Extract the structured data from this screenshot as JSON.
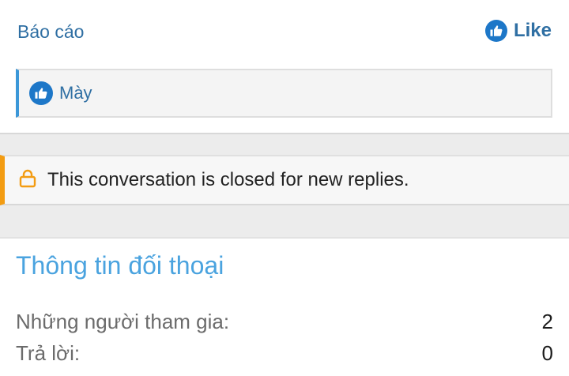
{
  "post_actions": {
    "report_label": "Báo cáo",
    "like_label": "Like"
  },
  "likes": {
    "names": "Mày"
  },
  "notice": {
    "text": "This conversation is closed for new replies."
  },
  "conversation_info": {
    "title": "Thông tin đối thoại",
    "rows": [
      {
        "label": "Những người tham gia:",
        "value": "2"
      },
      {
        "label": "Trả lời:",
        "value": "0"
      }
    ]
  },
  "colors": {
    "link": "#2f6fa3",
    "like_icon": "#1d77c8",
    "accent_blue": "#3b97d8",
    "notice_accent": "#f39c12"
  }
}
